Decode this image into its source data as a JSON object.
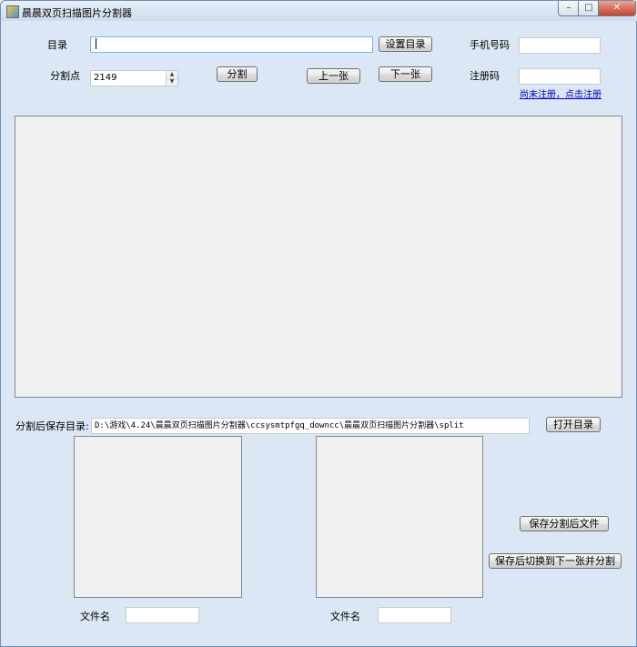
{
  "window": {
    "title": "晨晨双页扫描图片分割器",
    "controls": {
      "minimize": "–",
      "maximize": "□",
      "close": "✕"
    }
  },
  "top": {
    "dir_label": "目录",
    "dir_value": "",
    "set_dir_button": "设置目录",
    "phone_label": "手机号码",
    "phone_value": "",
    "split_point_label": "分割点",
    "split_point_value": "2149",
    "split_button": "分割",
    "prev_button": "上一张",
    "next_button": "下一张",
    "reg_code_label": "注册码",
    "reg_code_value": "",
    "register_link": "尚未注册，点击注册"
  },
  "bottom": {
    "save_dir_label": "分割后保存目录:",
    "save_dir_value": "D:\\游戏\\4.24\\晨晨双页扫描图片分割器\\ccsysmtpfgq_downcc\\晨晨双页扫描图片分割器\\split",
    "open_dir_button": "打开目录",
    "save_split_button": "保存分割后文件",
    "save_next_button": "保存后切换到下一张并分割",
    "left_filename_label": "文件名",
    "left_filename_value": "",
    "right_filename_label": "文件名",
    "right_filename_value": ""
  },
  "icons": {
    "app_icon": "app-logo-icon",
    "spin_up": "chevron-up-icon",
    "spin_down": "chevron-down-icon"
  }
}
